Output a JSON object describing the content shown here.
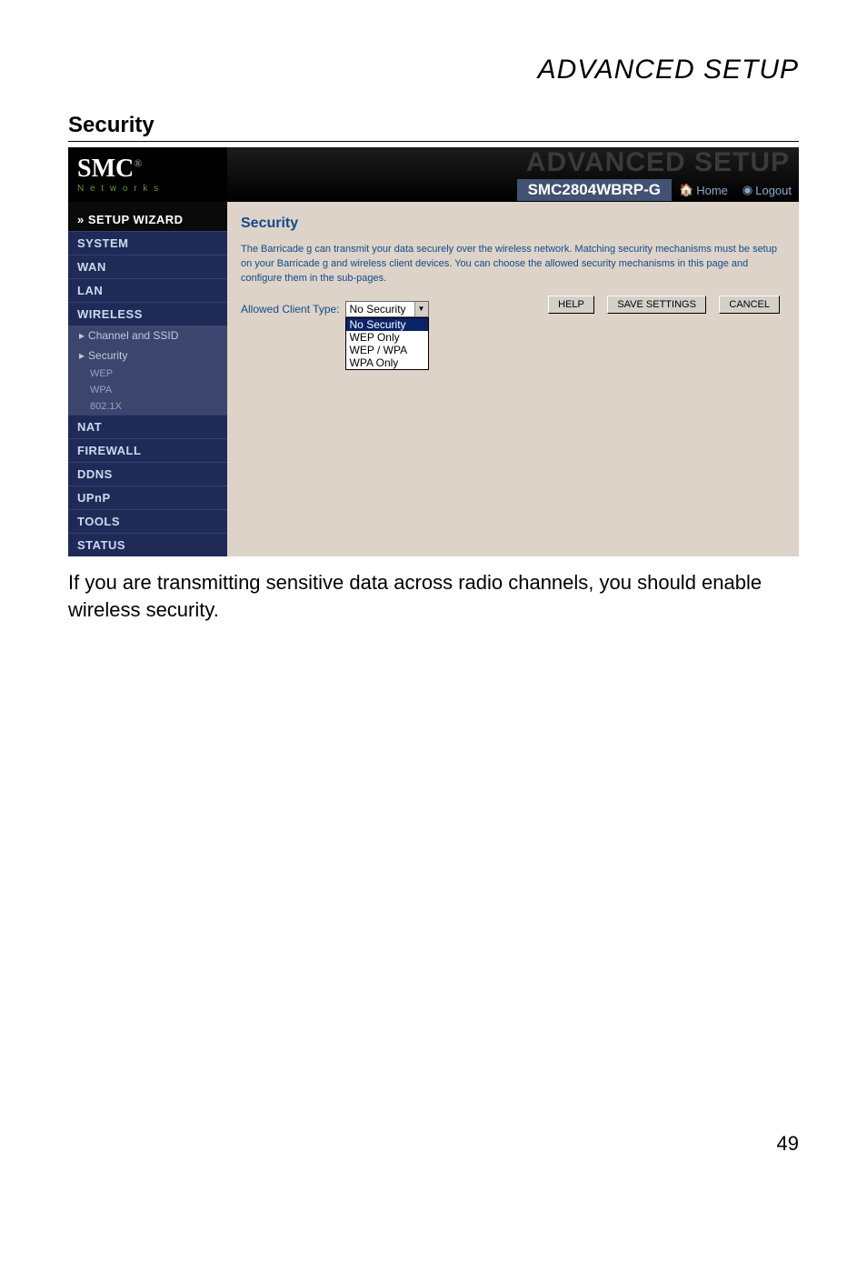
{
  "header": {
    "page_title": "ADVANCED SETUP",
    "section_heading": "Security"
  },
  "router": {
    "logo": {
      "brand": "SMC",
      "reg": "®",
      "sub": "N e t w o r k s"
    },
    "banner": {
      "ghost": "ADVANCED SETUP",
      "model": "SMC2804WBRP-G",
      "home": "Home",
      "logout": "Logout"
    },
    "nav": {
      "wizard": "» SETUP WIZARD",
      "system": "SYSTEM",
      "wan": "WAN",
      "lan": "LAN",
      "wireless": "WIRELESS",
      "channel_ssid": "Channel and SSID",
      "security": "Security",
      "wep": "WEP",
      "wpa": "WPA",
      "dot1x": "802.1X",
      "nat": "NAT",
      "firewall": "FIREWALL",
      "ddns": "DDNS",
      "upnp": "UPnP",
      "tools": "TOOLS",
      "status": "STATUS"
    },
    "content": {
      "title": "Security",
      "description": "The Barricade g can transmit your data securely over the wireless network. Matching security mechanisms must be setup on your Barricade g and wireless client devices. You can choose the allowed security mechanisms in this page and configure them in the sub-pages.",
      "allowed_label": "Allowed Client Type:",
      "select_value": "No Security",
      "options": {
        "no_security": "No Security",
        "wep_only": "WEP Only",
        "wep_wpa": "WEP / WPA",
        "wpa_only": "WPA Only"
      },
      "buttons": {
        "help": "HELP",
        "save": "SAVE SETTINGS",
        "cancel": "CANCEL"
      }
    }
  },
  "body_text": "If you are transmitting sensitive data across radio channels, you should enable wireless security.",
  "page_number": "49"
}
